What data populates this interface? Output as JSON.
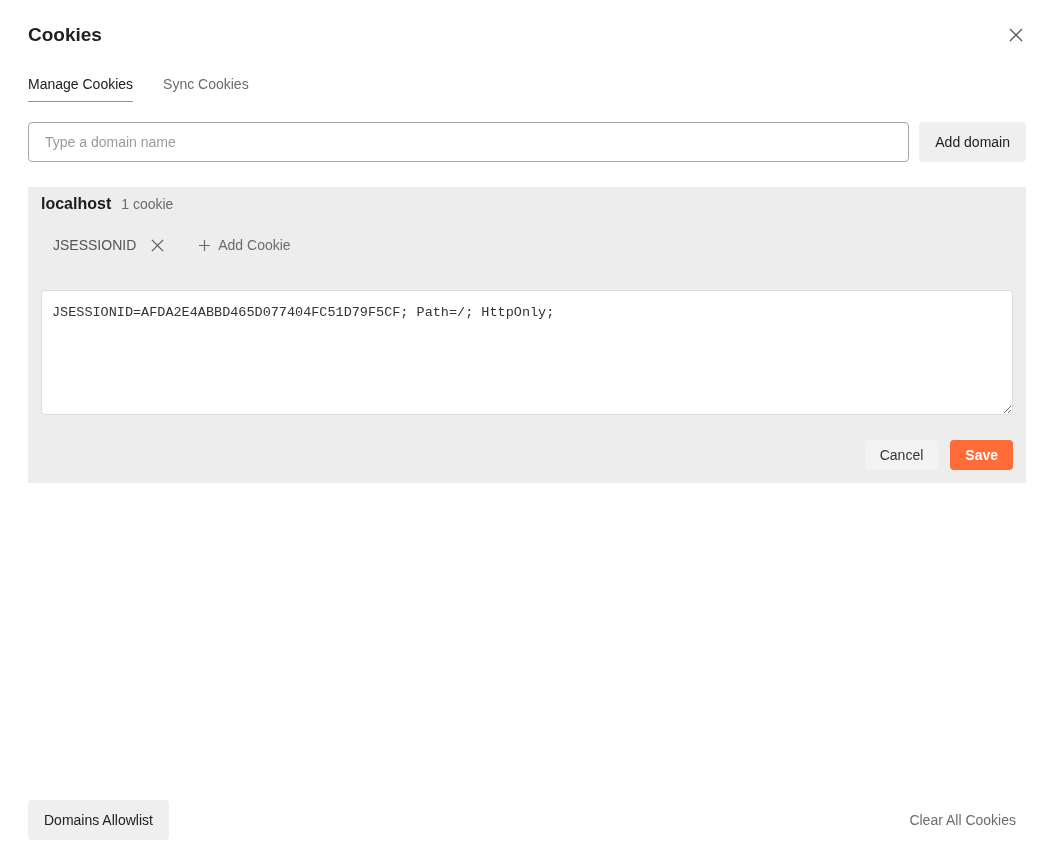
{
  "dialog": {
    "title": "Cookies"
  },
  "tabs": [
    {
      "label": "Manage Cookies",
      "selected": true
    },
    {
      "label": "Sync Cookies",
      "selected": false
    }
  ],
  "domain_input": {
    "placeholder": "Type a domain name"
  },
  "add_domain_button": "Add domain",
  "domains": [
    {
      "name": "localhost",
      "count": "1 cookie",
      "cookies": [
        {
          "name": "JSESSIONID"
        }
      ],
      "add_cookie": "Add Cookie",
      "editor_value": "JSESSIONID=AFDA2E4ABBD465D077404FC51D79F5CF; Path=/; HttpOnly;",
      "cancel": "Cancel",
      "save": "Save"
    }
  ],
  "footer": {
    "allowlist_button": "Domains Allowlist",
    "clear_link": "Clear All Cookies"
  }
}
